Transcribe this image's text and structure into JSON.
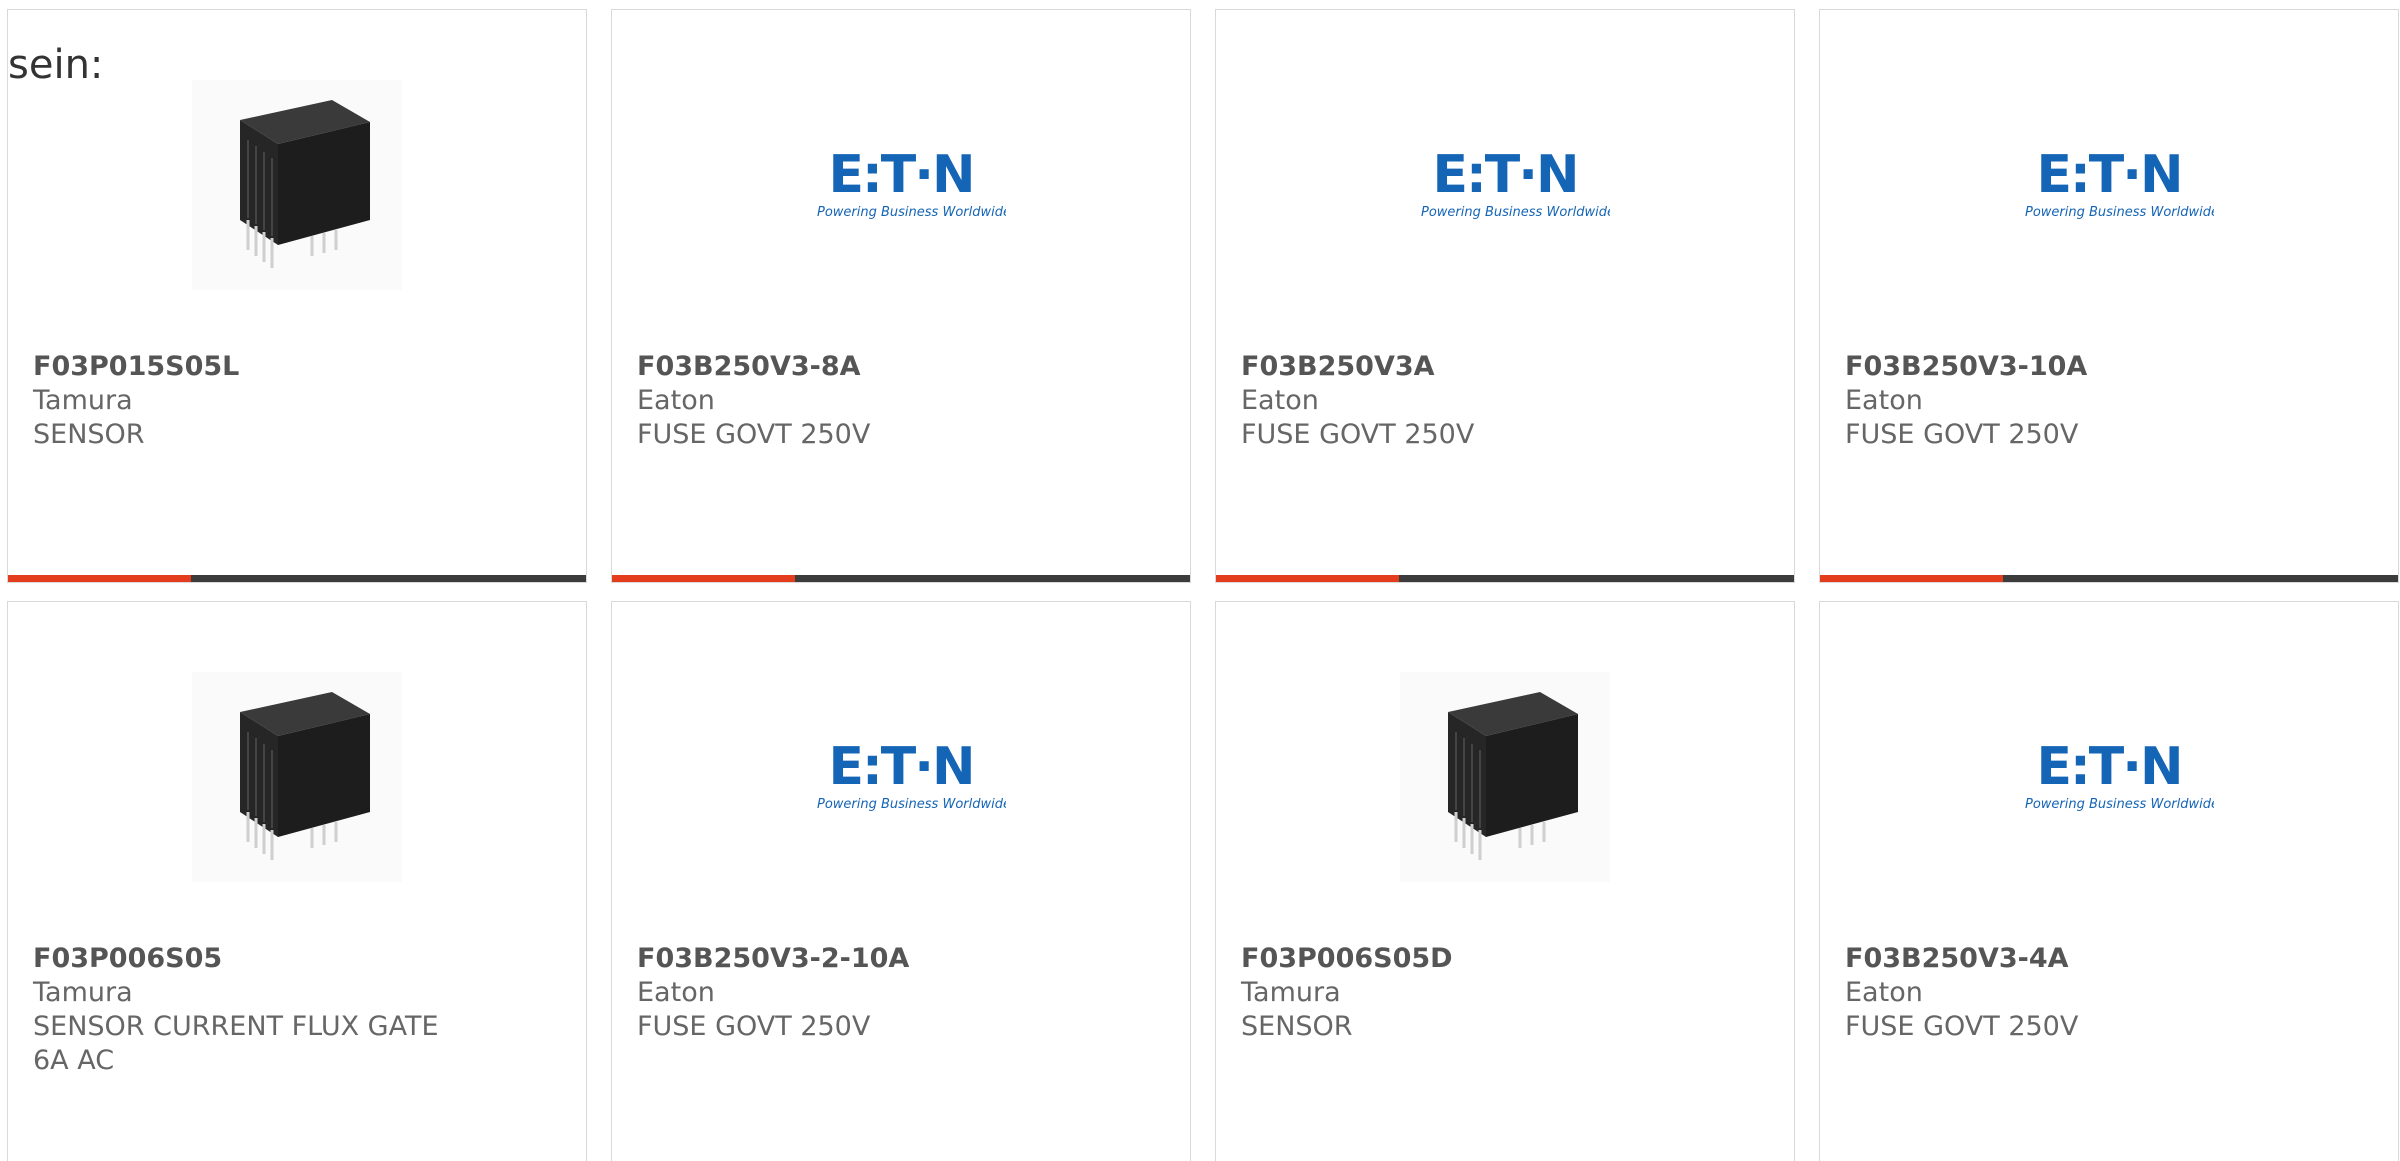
{
  "intro_text": "sein:",
  "brand_colors": {
    "accent_bar": "#e33d1e",
    "bar": "#3c3c3c",
    "eaton_blue": "#1565b6"
  },
  "eaton_tagline": "Powering Business Worldwide",
  "products": [
    {
      "part": "F03P015S05L",
      "manufacturer": "Tamura",
      "description": "SENSOR",
      "image": "sensor-component-image"
    },
    {
      "part": "F03B250V3-8A",
      "manufacturer": "Eaton",
      "description": "FUSE GOVT 250V",
      "image": "eaton-logo"
    },
    {
      "part": "F03B250V3A",
      "manufacturer": "Eaton",
      "description": "FUSE GOVT 250V",
      "image": "eaton-logo"
    },
    {
      "part": "F03B250V3-10A",
      "manufacturer": "Eaton",
      "description": "FUSE GOVT 250V",
      "image": "eaton-logo"
    },
    {
      "part": "F03P006S05",
      "manufacturer": "Tamura",
      "description": "SENSOR CURRENT FLUX GATE 6A AC",
      "image": "sensor-component-image"
    },
    {
      "part": "F03B250V3-2-10A",
      "manufacturer": "Eaton",
      "description": "FUSE GOVT 250V",
      "image": "eaton-logo"
    },
    {
      "part": "F03P006S05D",
      "manufacturer": "Tamura",
      "description": "SENSOR",
      "image": "sensor-component-image"
    },
    {
      "part": "F03B250V3-4A",
      "manufacturer": "Eaton",
      "description": "FUSE GOVT 250V",
      "image": "eaton-logo"
    }
  ]
}
